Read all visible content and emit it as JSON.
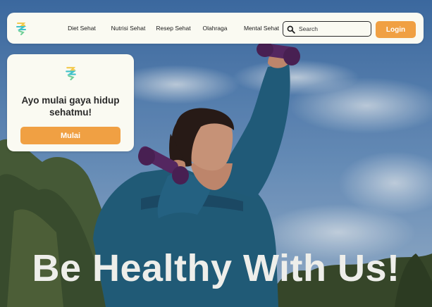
{
  "navbar": {
    "logo_icon": "leaf-logo-icon",
    "links": [
      {
        "label": "Diet Sehat"
      },
      {
        "label": "Nutrisi Sehat"
      },
      {
        "label": "Resep Sehat"
      },
      {
        "label": "Olahraga"
      },
      {
        "label": "Mental Sehat"
      }
    ],
    "search": {
      "placeholder": "Search",
      "value": "",
      "icon": "search-icon"
    },
    "login_label": "Login"
  },
  "promo_card": {
    "logo_icon": "leaf-logo-icon",
    "heading": "Ayo mulai gaya hidup sehatmu!",
    "button_label": "Mulai"
  },
  "hero": {
    "title": "Be Healthy With Us!"
  },
  "colors": {
    "accent": "#f0a043",
    "surface": "#fafaf2",
    "text_dark": "#2a2a2a",
    "hero_text": "#eeeeea",
    "sky": "#5a86b8",
    "jacket": "#23607e",
    "dumbbell": "#5a2a66"
  }
}
